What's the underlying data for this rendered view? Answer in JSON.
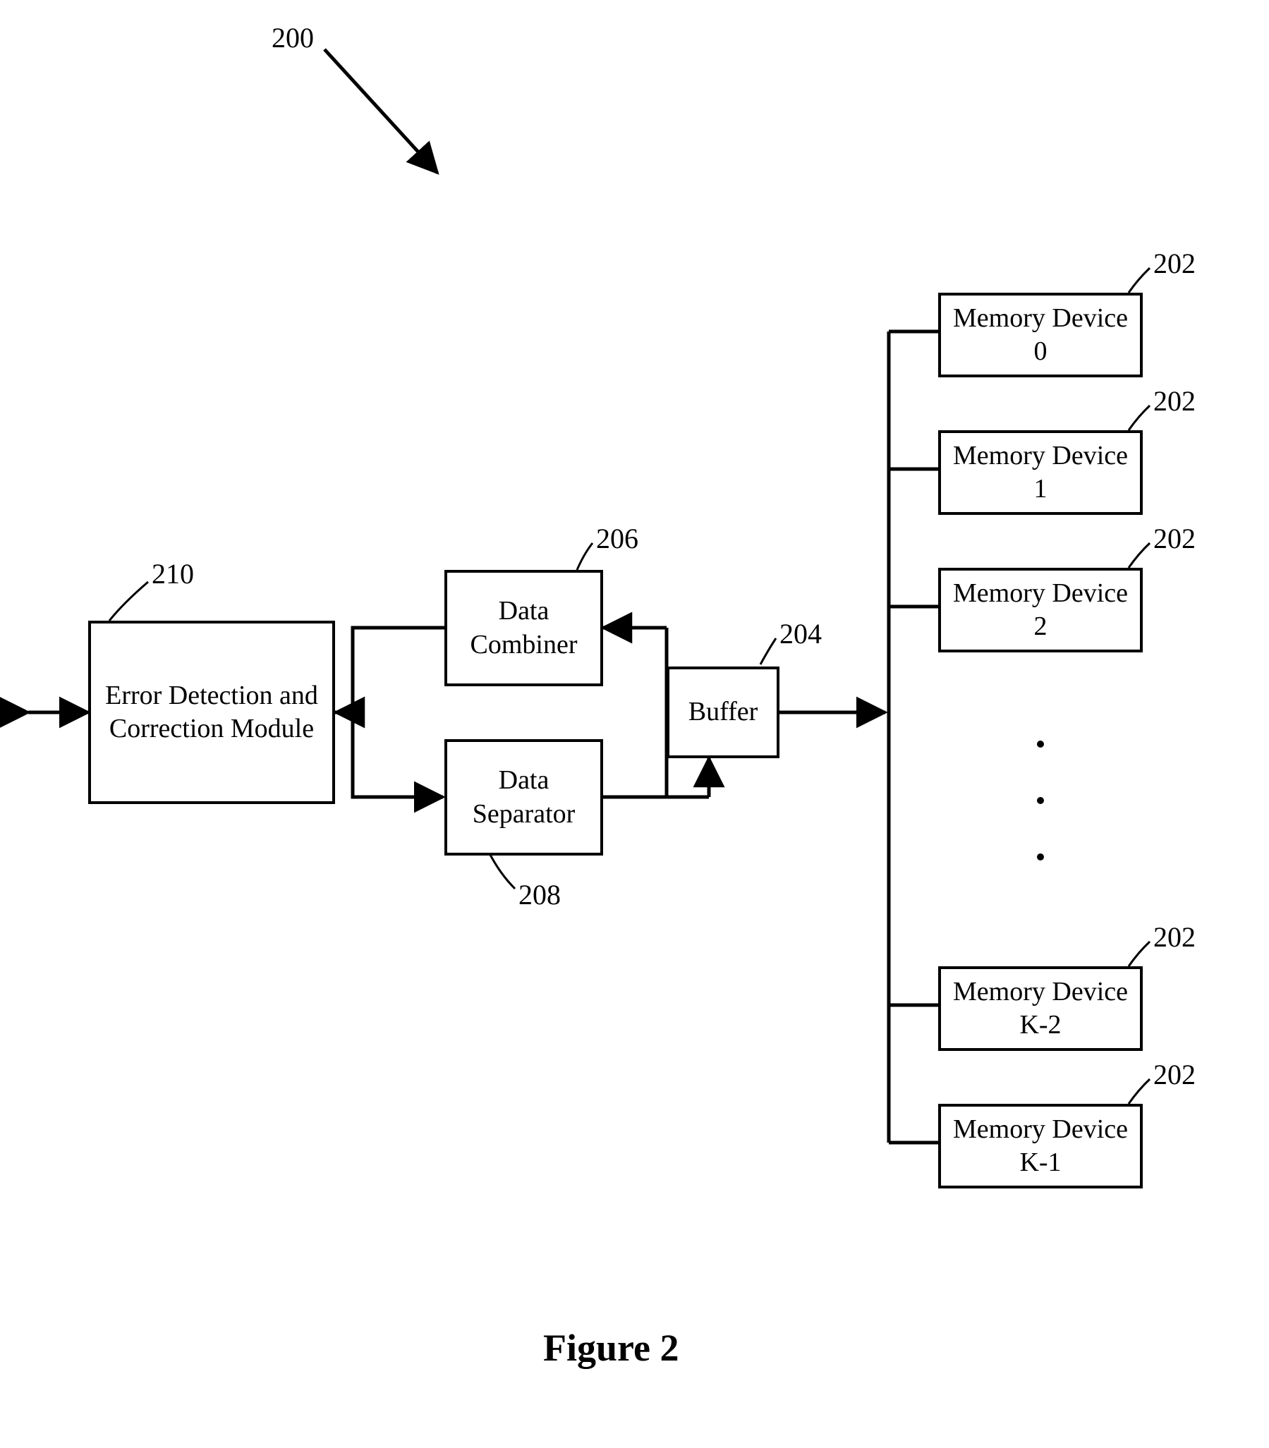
{
  "figure": {
    "overall_ref": "200",
    "caption": "Figure 2"
  },
  "blocks": {
    "edc": {
      "label": "Error Detection and Correction Module",
      "ref": "210"
    },
    "combiner": {
      "label": "Data Combiner",
      "ref": "206"
    },
    "separator": {
      "label": "Data Separator",
      "ref": "208"
    },
    "buffer": {
      "label": "Buffer",
      "ref": "204"
    },
    "mem0": {
      "label": "Memory Device 0",
      "ref": "202"
    },
    "mem1": {
      "label": "Memory Device 1",
      "ref": "202"
    },
    "mem2": {
      "label": "Memory Device 2",
      "ref": "202"
    },
    "memK2": {
      "label": "Memory Device K-2",
      "ref": "202"
    },
    "memK1": {
      "label": "Memory Device K-1",
      "ref": "202"
    }
  }
}
